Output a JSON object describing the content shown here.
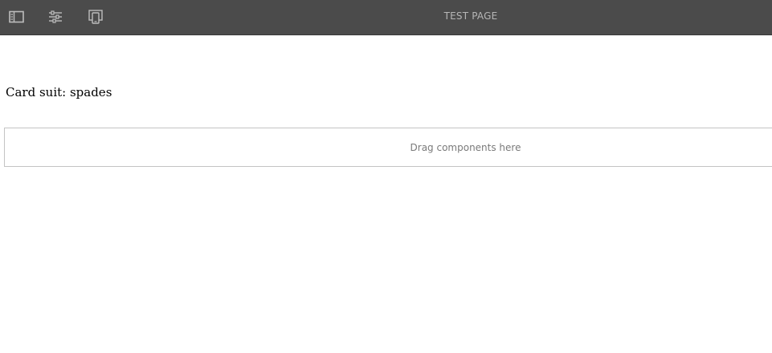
{
  "toolbar": {
    "title": "TEST PAGE",
    "icons": {
      "side_panel": "side-panel-icon",
      "properties": "sliders-icon",
      "emulator": "device-preview-icon"
    },
    "colors": {
      "background": "#4b4b4b",
      "icon": "#bdbdbd",
      "title": "#b6b6b6"
    }
  },
  "main": {
    "text": "Card suit: spades",
    "dropzone": {
      "label": "Drag components here"
    }
  }
}
